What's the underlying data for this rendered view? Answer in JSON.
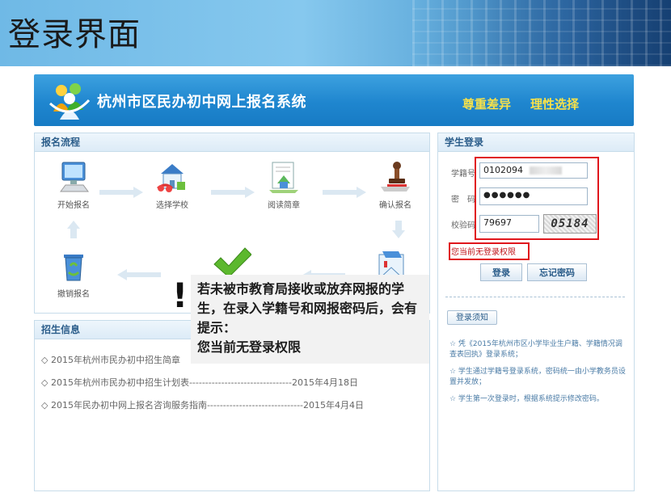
{
  "slide_title": "登录界面",
  "banner": {
    "system_title": "杭州市区民办初中网上报名系统",
    "slogan_1": "尊重差异",
    "slogan_2": "理性选择"
  },
  "process": {
    "heading": "报名流程",
    "steps": [
      {
        "label": "开始报名",
        "icon": "computer-icon"
      },
      {
        "label": "选择学校",
        "icon": "school-icon"
      },
      {
        "label": "阅读简章",
        "icon": "document-icon"
      },
      {
        "label": "确认报名",
        "icon": "stamp-icon"
      },
      {
        "label": "撤销报名",
        "icon": "recycle-bin-icon"
      }
    ]
  },
  "recruit": {
    "heading": "招生信息",
    "items": [
      {
        "text": "◇ 2015年杭州市民办初中招生简章"
      },
      {
        "text": "◇ 2015年杭州市民办初中招生计划表--------------------------------2015年4月18日"
      },
      {
        "text": "◇ 2015年民办初中网上报名咨询服务指南------------------------------2015年4月4日"
      }
    ]
  },
  "login": {
    "heading": "学生登录",
    "student_id_label": "学籍号",
    "student_id_value": "0102094",
    "password_label": "密　码",
    "password_value": "●●●●●●",
    "captcha_label": "校验码",
    "captcha_input_value": "79697",
    "captcha_image_text": "05184",
    "warning": "您当前无登录权限",
    "login_button": "登录",
    "forgot_button": "忘记密码",
    "notice_title": "登录须知",
    "notices": [
      "☆ 凭《2015年杭州市区小学毕业生户籍、学籍情况调查表回执》登录系统；",
      "☆ 学生通过学籍号登录系统，密码统一由小学教务员设置并发放；",
      "☆ 学生第一次登录时，根据系统提示修改密码。"
    ]
  },
  "callout": {
    "mark": "!",
    "text": "若未被市教育局接收或放弃网报的学生，在录入学籍号和网报密码后，会有提示：\n您当前无登录权限"
  },
  "colors": {
    "banner_blue": "#1f86cf",
    "slogan_yellow": "#f7e14a",
    "highlight_red": "#e0161c",
    "link_blue": "#2b5d8a"
  }
}
